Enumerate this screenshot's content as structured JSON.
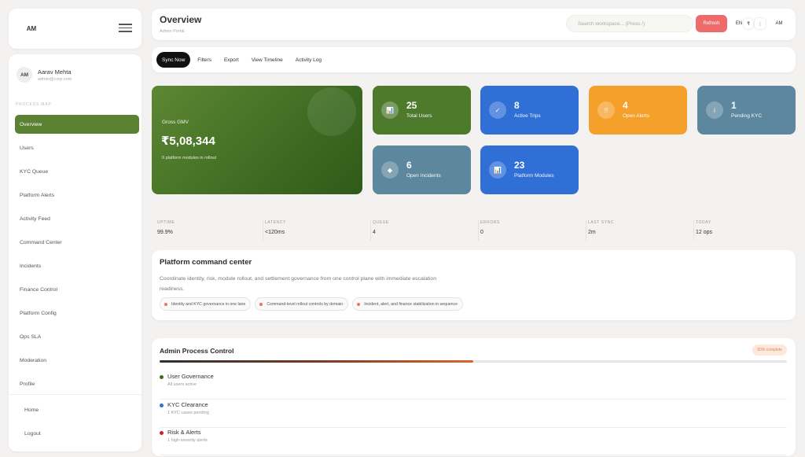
{
  "app": {
    "logo": "AM"
  },
  "user": {
    "initials": "AM",
    "name": "Aarav Mehta",
    "email": "admin@corp.com"
  },
  "sidebar": {
    "section_label": "PROCESS MAP",
    "items": [
      {
        "label": "Overview",
        "active": true
      },
      {
        "label": "Users"
      },
      {
        "label": "KYC Queue"
      },
      {
        "label": "Platform Alerts"
      },
      {
        "label": "Activity Feed"
      },
      {
        "label": "Command Center"
      },
      {
        "label": "Incidents"
      },
      {
        "label": "Finance Control"
      },
      {
        "label": "Platform Config"
      },
      {
        "label": "Ops SLA"
      },
      {
        "label": "Moderation"
      },
      {
        "label": "Profile"
      }
    ],
    "bottom": [
      {
        "label": "Home"
      },
      {
        "label": "Logout"
      }
    ]
  },
  "header": {
    "title": "Overview",
    "subtitle": "Admin Portal",
    "search_placeholder": "Search workspace... (Press /)",
    "refresh_label": "Refresh",
    "lang": "EN",
    "currency": "₹",
    "menu": "⋮",
    "avatar": "AM"
  },
  "toolbar": {
    "buttons": [
      "Sync Now",
      "Filters",
      "Export",
      "View Timeline",
      "Activity Log"
    ]
  },
  "hero": {
    "label": "Gross GMV",
    "value": "₹5,08,344",
    "sub": "0 platform modules in rollout"
  },
  "stats": [
    {
      "value": "25",
      "label": "Total Users",
      "icon": "bar-chart-icon",
      "glyph": "📊",
      "color": "#4e7a2c"
    },
    {
      "value": "8",
      "label": "Active Trips",
      "icon": "check-icon",
      "glyph": "✓",
      "color": "#2f6fd6"
    },
    {
      "value": "4",
      "label": "Open Alerts",
      "icon": "alert-icon",
      "glyph": "!!",
      "color": "#f6a02c"
    },
    {
      "value": "1",
      "label": "Pending KYC",
      "icon": "info-icon",
      "glyph": "i",
      "color": "#5c879e"
    },
    {
      "value": "6",
      "label": "Open Incidents",
      "icon": "diamond-icon",
      "glyph": "◆",
      "color": "#5d879c"
    },
    {
      "value": "23",
      "label": "Platform Modules",
      "icon": "bar-chart-icon",
      "glyph": "📊",
      "color": "#2f6fd6"
    }
  ],
  "metrics": [
    {
      "label": "UPTIME",
      "value": "99.9%"
    },
    {
      "label": "LATENCY",
      "value": "<120ms"
    },
    {
      "label": "QUEUE",
      "value": "4"
    },
    {
      "label": "ERRORS",
      "value": "0"
    },
    {
      "label": "LAST SYNC",
      "value": "2m"
    },
    {
      "label": "TODAY",
      "value": "12 ops"
    }
  ],
  "command": {
    "title": "Platform command center",
    "description": "Coordinate identity, risk, module rollout, and settlement governance from one control plane with immediate escalation readiness.",
    "tags": [
      "Identity and KYC governance in one lane",
      "Command-level rollout controls by domain",
      "Incident, alert, and finance stabilization in sequence"
    ]
  },
  "process": {
    "title": "Admin Process Control",
    "badge": "50% complete",
    "progress": 0.5,
    "items": [
      {
        "name": "User Governance",
        "sub": "All users active",
        "color": "#3e6c22"
      },
      {
        "name": "KYC Clearance",
        "sub": "1 KYC cases pending",
        "color": "#2f6fd6"
      },
      {
        "name": "Risk & Alerts",
        "sub": "1 high-severity alerts",
        "color": "#c62828"
      }
    ]
  }
}
